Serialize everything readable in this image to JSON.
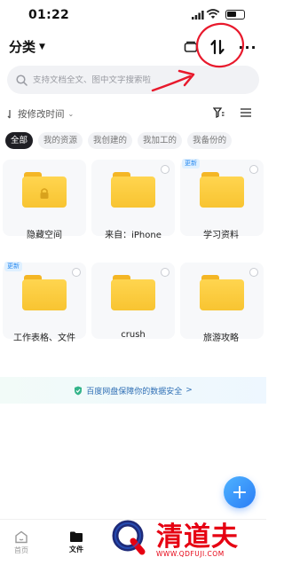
{
  "status_bar": {
    "time": "01:22"
  },
  "header": {
    "title": "分类"
  },
  "search": {
    "placeholder": "支持文档全文、图中文字搜索啦"
  },
  "sort": {
    "label": "按修改时间"
  },
  "filter_chips": [
    {
      "label": "全部",
      "active": true
    },
    {
      "label": "我的资源",
      "active": false
    },
    {
      "label": "我创建的",
      "active": false
    },
    {
      "label": "我加工的",
      "active": false
    },
    {
      "label": "我备份的",
      "active": false
    }
  ],
  "folders": [
    {
      "name": "隐藏空间",
      "locked": true,
      "badge": ""
    },
    {
      "name": "来自：iPhone",
      "locked": false,
      "badge": ""
    },
    {
      "name": "学习资料",
      "locked": false,
      "badge": "更新"
    },
    {
      "name": "工作表格、文件",
      "locked": false,
      "badge": "更新"
    },
    {
      "name": "crush",
      "locked": false,
      "badge": ""
    },
    {
      "name": "旅游攻略",
      "locked": false,
      "badge": ""
    }
  ],
  "safety_banner": {
    "text": "百度网盘保障你的数据安全",
    "arrow": ">"
  },
  "fab": {
    "icon": "plus-icon",
    "symbol": "+"
  },
  "tab_bar": [
    {
      "label": "首页",
      "icon": "home-icon",
      "active": false
    },
    {
      "label": "文件",
      "icon": "folder-icon",
      "active": true
    }
  ],
  "watermark": {
    "text": "清道夫",
    "url": "WWW.QDFUJI.COM"
  },
  "colors": {
    "accent": "#2a7cf6",
    "folder": "#f8c431",
    "annotation": "#e8192c"
  }
}
